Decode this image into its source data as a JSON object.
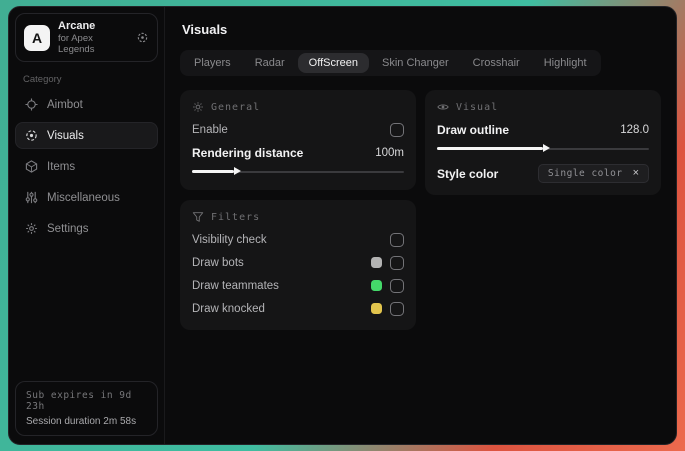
{
  "app": {
    "logo_letter": "A",
    "name": "Arcane",
    "subtitle": "for Apex Legends"
  },
  "sidebar": {
    "category_label": "Category",
    "items": [
      {
        "label": "Aimbot"
      },
      {
        "label": "Visuals"
      },
      {
        "label": "Items"
      },
      {
        "label": "Miscellaneous"
      },
      {
        "label": "Settings"
      }
    ],
    "footer": {
      "line1": "Sub expires in 9d 23h",
      "line2": "Session duration 2m 58s"
    }
  },
  "header": {
    "title": "Visuals"
  },
  "tabs": [
    {
      "label": "Players"
    },
    {
      "label": "Radar"
    },
    {
      "label": "OffScreen"
    },
    {
      "label": "Skin Changer"
    },
    {
      "label": "Crosshair"
    },
    {
      "label": "Highlight"
    }
  ],
  "panels": {
    "general": {
      "title": "General",
      "enable_label": "Enable",
      "enable_checked": false,
      "distance_label": "Rendering distance",
      "distance_value": "100m",
      "distance_fill": "20%"
    },
    "filters": {
      "title": "Filters",
      "rows": [
        {
          "label": "Visibility check",
          "swatch": null,
          "checked": false
        },
        {
          "label": "Draw bots",
          "swatch": "#b3b3b3",
          "checked": false
        },
        {
          "label": "Draw teammates",
          "swatch": "#44d96a",
          "checked": false
        },
        {
          "label": "Draw knocked",
          "swatch": "#e2c44d",
          "checked": false
        }
      ]
    },
    "visual": {
      "title": "Visual",
      "outline_label": "Draw outline",
      "outline_value": "128.0",
      "outline_fill": "50%",
      "style_label": "Style color",
      "style_value": "Single color",
      "style_clear": "×"
    }
  },
  "colors": {
    "bg_teal": "#3fbda1",
    "bg_red": "#dd5440",
    "panel_bg": "#151516",
    "accent_text": "#f2f2f3"
  }
}
